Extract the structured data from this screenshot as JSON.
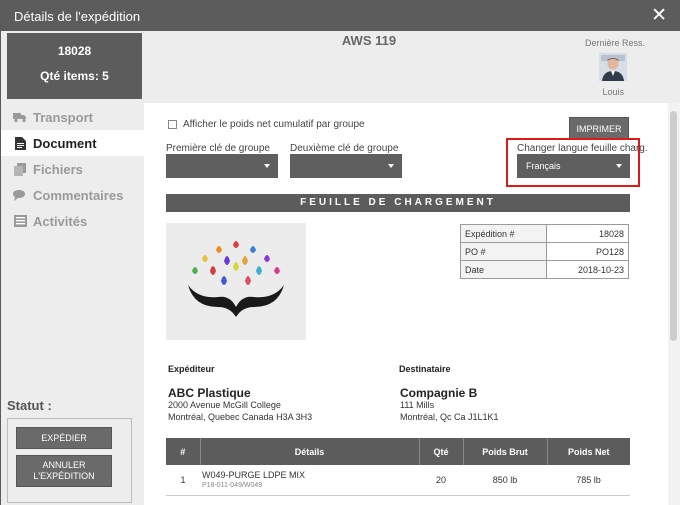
{
  "window": {
    "title": "Détails de l'expédition",
    "close_icon": "close-icon"
  },
  "shipment": {
    "number": "18028",
    "qty_items": "Qté items: 5"
  },
  "header": {
    "carrier_code": "AWS 119",
    "last_resource_label": "Dernière Ress.",
    "user_name": "Louis"
  },
  "sidebar": {
    "items": [
      {
        "label": "Transport",
        "icon": "truck-icon",
        "active": false
      },
      {
        "label": "Document",
        "icon": "document-icon",
        "active": true
      },
      {
        "label": "Fichiers",
        "icon": "files-icon",
        "active": false
      },
      {
        "label": "Commentaires",
        "icon": "comments-icon",
        "active": false
      },
      {
        "label": "Activités",
        "icon": "activities-icon",
        "active": false
      }
    ],
    "status_label": "Statut :",
    "ship_button": "EXPÉDIER",
    "cancel_button_line1": "ANNULER",
    "cancel_button_line2": "L'EXPÉDITION"
  },
  "document": {
    "checkbox_label": "Afficher le poids net cumulatif par groupe",
    "print_button": "IMPRIMER",
    "first_group_label": "Première clé de groupe",
    "first_group_value": "",
    "second_group_label": "Deuxième clé de groupe",
    "second_group_value": "",
    "language_label": "Changer langue feuille charg.",
    "language_value": "Français",
    "banner": "FEUILLE DE CHARGEMENT",
    "info": [
      {
        "key": "Expédition #",
        "value": "18028"
      },
      {
        "key": "PO #",
        "value": "PO128"
      },
      {
        "key": "Date",
        "value": "2018-10-23"
      }
    ],
    "shipper": {
      "heading": "Expéditeur",
      "name": "ABC Plastique",
      "line1": "2000 Avenue McGill College",
      "line2": "Montréal, Quebec Canada H3A 3H3"
    },
    "consignee": {
      "heading": "Destinataire",
      "name": "Compagnie B",
      "line1": "111 Mills",
      "line2": "Montréal, Qc Ca J1L1K1"
    },
    "table": {
      "headers": [
        "#",
        "Détails",
        "Qté",
        "Poids Brut",
        "Poids Net"
      ],
      "rows": [
        {
          "num": "1",
          "detail": "W049-PURGE LDPE MIX",
          "sku": "P18-011-049/W049",
          "qty": "20",
          "gross": "850 lb",
          "net": "785 lb"
        }
      ]
    }
  },
  "colors": {
    "dark": "#5c5c5c",
    "highlight": "#e01818",
    "panel": "#ededed"
  }
}
